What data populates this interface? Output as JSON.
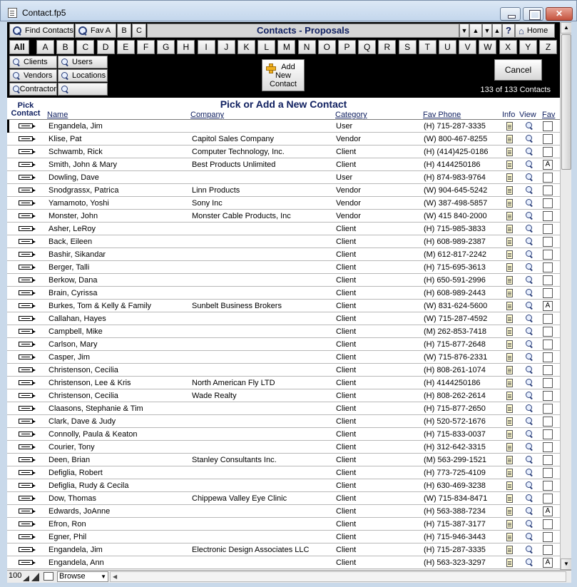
{
  "window": {
    "title": "Contact.fp5"
  },
  "toolbar": {
    "find_contacts": "Find Contacts",
    "fav_a": "Fav A",
    "btn_b": "B",
    "btn_c": "C",
    "layout_title": "Contacts - Proposals",
    "help": "?",
    "home": "Home"
  },
  "letters": [
    "All",
    "A",
    "B",
    "C",
    "D",
    "E",
    "F",
    "G",
    "H",
    "I",
    "J",
    "K",
    "L",
    "M",
    "N",
    "O",
    "P",
    "Q",
    "R",
    "S",
    "T",
    "U",
    "V",
    "W",
    "X",
    "Y",
    "Z"
  ],
  "quick_finds": [
    "Clients",
    "Users",
    "Vendors",
    "Locations",
    "Contractor",
    ""
  ],
  "add_button": {
    "line1": "Add",
    "line2": "New",
    "line3": "Contact"
  },
  "cancel_label": "Cancel",
  "count_text": "133 of 133 Contacts",
  "list": {
    "title": "Pick or Add a New Contact",
    "pick_l1": "Pick",
    "pick_l2": "Contact",
    "col_name": "Name",
    "col_company": "Company",
    "col_category": "Category",
    "col_phone": "Fav Phone",
    "col_info": "Info",
    "col_view": "View",
    "col_fav": "Fav"
  },
  "rows": [
    {
      "name": "Engandela, Jim",
      "company": "",
      "category": "User",
      "phone": "(H) 715-287-3335",
      "fav": ""
    },
    {
      "name": "Klise, Pat",
      "company": "Capitol Sales Company",
      "category": "Vendor",
      "phone": "(W) 800-467-8255",
      "fav": ""
    },
    {
      "name": "Schwamb, Rick",
      "company": "Computer Technology, Inc.",
      "category": "Client",
      "phone": "(H) (414)425-0186",
      "fav": ""
    },
    {
      "name": "Smith, John & Mary",
      "company": "Best Products Unlimited",
      "category": "Client",
      "phone": "(H) 4144250186",
      "fav": "A"
    },
    {
      "name": "Dowling, Dave",
      "company": "",
      "category": "User",
      "phone": "(H) 874-983-9764",
      "fav": ""
    },
    {
      "name": "Snodgrassx, Patrica",
      "company": "Linn Products",
      "category": "Vendor",
      "phone": "(W) 904-645-5242",
      "fav": ""
    },
    {
      "name": "Yamamoto, Yoshi",
      "company": "Sony Inc",
      "category": "Vendor",
      "phone": "(W) 387-498-5857",
      "fav": ""
    },
    {
      "name": "Monster, John",
      "company": "Monster Cable Products, Inc",
      "category": "Vendor",
      "phone": "(W) 415 840-2000",
      "fav": ""
    },
    {
      "name": "Asher, LeRoy",
      "company": "",
      "category": "Client",
      "phone": "(H) 715-985-3833",
      "fav": ""
    },
    {
      "name": "Back, Eileen",
      "company": "",
      "category": "Client",
      "phone": "(H) 608-989-2387",
      "fav": ""
    },
    {
      "name": "Bashir, Sikandar",
      "company": "",
      "category": "Client",
      "phone": "(M) 612-817-2242",
      "fav": ""
    },
    {
      "name": "Berger, Talli",
      "company": "",
      "category": "Client",
      "phone": "(H) 715-695-3613",
      "fav": ""
    },
    {
      "name": "Berkow, Dana",
      "company": "",
      "category": "Client",
      "phone": "(H) 650-591-2996",
      "fav": ""
    },
    {
      "name": "Brain, Cyrissa",
      "company": "",
      "category": "Client",
      "phone": "(H) 608-989-2443",
      "fav": ""
    },
    {
      "name": "Burkes, Tom & Kelly & Family",
      "company": "Sunbelt Business Brokers",
      "category": "Client",
      "phone": "(W) 831-624-5600",
      "fav": "A"
    },
    {
      "name": "Callahan, Hayes",
      "company": "",
      "category": "Client",
      "phone": "(W) 715-287-4592",
      "fav": ""
    },
    {
      "name": "Campbell, Mike",
      "company": "",
      "category": "Client",
      "phone": "(M) 262-853-7418",
      "fav": ""
    },
    {
      "name": "Carlson, Mary",
      "company": "",
      "category": "Client",
      "phone": "(H) 715-877-2648",
      "fav": ""
    },
    {
      "name": "Casper, Jim",
      "company": "",
      "category": "Client",
      "phone": "(W) 715-876-2331",
      "fav": ""
    },
    {
      "name": "Christenson, Cecilia",
      "company": "",
      "category": "Client",
      "phone": "(H) 808-261-1074",
      "fav": ""
    },
    {
      "name": "Christenson, Lee & Kris",
      "company": "North American Fly LTD",
      "category": "Client",
      "phone": "(H) 4144250186",
      "fav": ""
    },
    {
      "name": "Christenson, Cecilia",
      "company": "Wade Realty",
      "category": "Client",
      "phone": "(H) 808-262-2614",
      "fav": ""
    },
    {
      "name": "Claasons, Stephanie & Tim",
      "company": "",
      "category": "Client",
      "phone": "(H) 715-877-2650",
      "fav": ""
    },
    {
      "name": "Clark, Dave & Judy",
      "company": "",
      "category": "Client",
      "phone": "(H) 520-572-1676",
      "fav": ""
    },
    {
      "name": "Connolly, Paula & Keaton",
      "company": "",
      "category": "Client",
      "phone": "(H) 715-833-0037",
      "fav": ""
    },
    {
      "name": "Courier, Tony",
      "company": "",
      "category": "Client",
      "phone": "(H) 312-642-3315",
      "fav": ""
    },
    {
      "name": "Deen, Brian",
      "company": "Stanley Consultants Inc.",
      "category": "Client",
      "phone": "(M) 563-299-1521",
      "fav": ""
    },
    {
      "name": "Defiglia, Robert",
      "company": "",
      "category": "Client",
      "phone": "(H) 773-725-4109",
      "fav": ""
    },
    {
      "name": "Defiglia, Rudy & Cecila",
      "company": "",
      "category": "Client",
      "phone": "(H) 630-469-3238",
      "fav": ""
    },
    {
      "name": "Dow, Thomas",
      "company": "Chippewa Valley Eye Clinic",
      "category": "Client",
      "phone": "(W) 715-834-8471",
      "fav": ""
    },
    {
      "name": "Edwards, JoAnne",
      "company": "",
      "category": "Client",
      "phone": "(H) 563-388-7234",
      "fav": "A"
    },
    {
      "name": "Efron, Ron",
      "company": "",
      "category": "Client",
      "phone": "(H) 715-387-3177",
      "fav": ""
    },
    {
      "name": "Egner, Phil",
      "company": "",
      "category": "Client",
      "phone": "(H) 715-946-3443",
      "fav": ""
    },
    {
      "name": "Engandela, Jim",
      "company": "Electronic Design Associates LLC",
      "category": "Client",
      "phone": "(H) 715-287-3335",
      "fav": ""
    },
    {
      "name": "Engandela, Ann",
      "company": "",
      "category": "Client",
      "phone": "(H) 563-323-3297",
      "fav": "A"
    }
  ],
  "status": {
    "zoom": "100",
    "mode": "Browse"
  }
}
